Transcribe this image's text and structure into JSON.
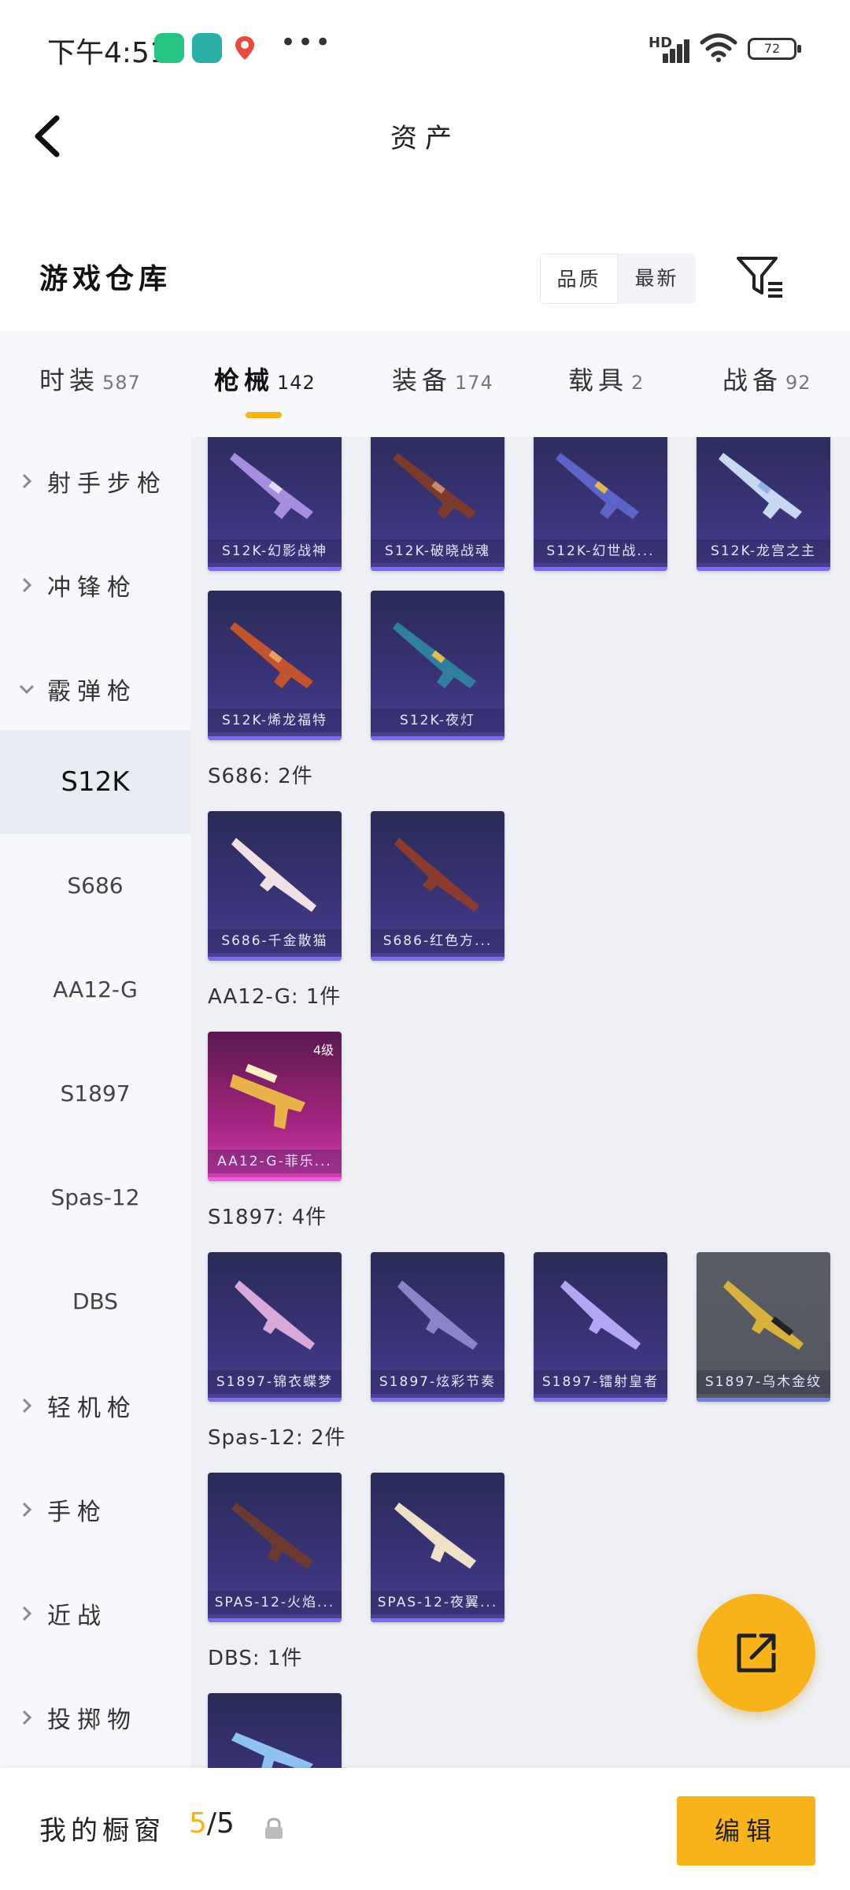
{
  "status_bar": {
    "time": "下午4:51",
    "network": "HD",
    "battery": "72"
  },
  "header": {
    "title": "资产"
  },
  "warehouse": {
    "title": "游戏仓库",
    "sort_options": [
      {
        "label": "品质"
      },
      {
        "label": "最新"
      }
    ]
  },
  "tabs": [
    {
      "label": "时装",
      "count": "587"
    },
    {
      "label": "枪械",
      "count": "142"
    },
    {
      "label": "装备",
      "count": "174"
    },
    {
      "label": "载具",
      "count": "2"
    },
    {
      "label": "战备",
      "count": "92"
    }
  ],
  "sidebar": {
    "categories": [
      {
        "label": "射手步枪",
        "expanded": false
      },
      {
        "label": "冲锋枪",
        "expanded": false
      },
      {
        "label": "霰弹枪",
        "expanded": true
      }
    ],
    "subcategories": [
      {
        "label": "S12K",
        "active": true
      },
      {
        "label": "S686"
      },
      {
        "label": "AA12-G"
      },
      {
        "label": "S1897"
      },
      {
        "label": "Spas-12"
      },
      {
        "label": "DBS"
      }
    ],
    "more_categories": [
      {
        "label": "轻机枪"
      },
      {
        "label": "手枪"
      },
      {
        "label": "近战"
      },
      {
        "label": "投掷物"
      }
    ]
  },
  "groups": {
    "s12k": {
      "items": [
        {
          "name": "S12K-幻影战神"
        },
        {
          "name": "S12K-破晓战魂"
        },
        {
          "name": "S12K-幻世战..."
        },
        {
          "name": "S12K-龙宫之主"
        },
        {
          "name": "S12K-烯龙福特"
        },
        {
          "name": "S12K-夜灯"
        }
      ]
    },
    "s686": {
      "title": "S686: 2件",
      "items": [
        {
          "name": "S686-千金散猫"
        },
        {
          "name": "S686-红色方..."
        }
      ]
    },
    "aa12": {
      "title": "AA12-G: 1件",
      "items": [
        {
          "name": "AA12-G-菲乐...",
          "level": "4级"
        }
      ]
    },
    "s1897": {
      "title": "S1897: 4件",
      "items": [
        {
          "name": "S1897-锦衣蝶梦"
        },
        {
          "name": "S1897-炫彩节奏"
        },
        {
          "name": "S1897-镭射皇者"
        },
        {
          "name": "S1897-乌木金纹"
        }
      ]
    },
    "spas12": {
      "title": "Spas-12: 2件",
      "items": [
        {
          "name": "SPAS-12-火焰..."
        },
        {
          "name": "SPAS-12-夜翼..."
        }
      ]
    },
    "dbs": {
      "title": "DBS: 1件"
    }
  },
  "bottom_bar": {
    "showcase_label": "我的橱窗",
    "showcase_current": "5",
    "showcase_total": "/5",
    "edit_label": "编辑"
  },
  "colors": {
    "accent": "#f7b319",
    "card_blue": "#3a3478",
    "card_pink": "#d33fb3",
    "card_gray": "#55575f"
  }
}
